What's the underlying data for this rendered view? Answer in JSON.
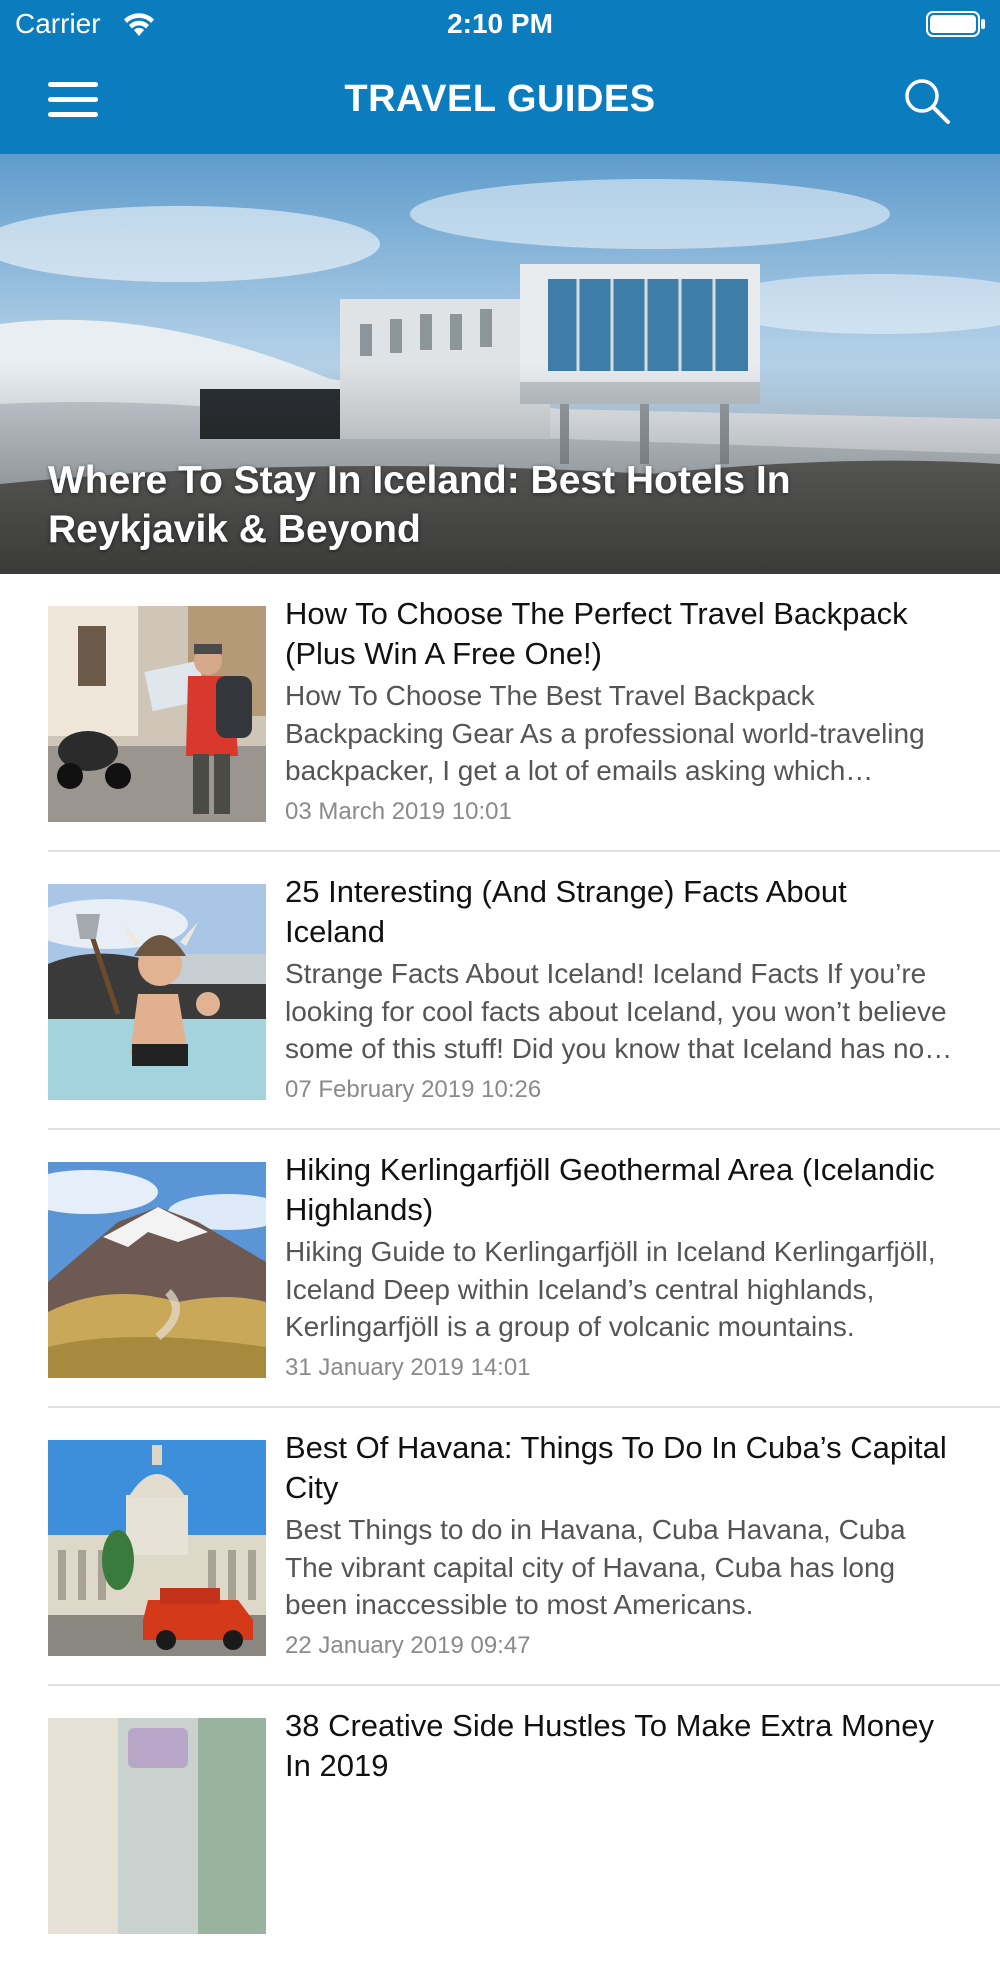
{
  "status_bar": {
    "carrier": "Carrier",
    "time": "2:10 PM",
    "icons": [
      "wifi-icon",
      "battery-icon"
    ]
  },
  "nav_bar": {
    "title": "TRAVEL GUIDES",
    "background": "#0b7dbf",
    "icons": [
      "hamburger-menu-icon",
      "search-icon"
    ]
  },
  "featured": {
    "title": "Where To Stay In Iceland: Best Hotels In Reykjavik & Beyond"
  },
  "articles": [
    {
      "title": "How To Choose The Perfect Travel Backpack (Plus Win A Free One!)",
      "excerpt": "How To Choose The Best Travel Backpack Backpacking Gear  As a professional world-traveling backpacker, I get a lot of emails asking which backpack is best.",
      "date": "03 March 2019 10:01"
    },
    {
      "title": "25 Interesting (And Strange) Facts About Iceland",
      "excerpt": "Strange Facts About Iceland!   Iceland Facts If you’re looking for cool facts about Iceland, you won’t believe some of this stuff! Did you know that Iceland has no mosquitoes?",
      "date": "07 February 2019 10:26"
    },
    {
      "title": "Hiking Kerlingarfjöll Geothermal Area (Icelandic Highlands)",
      "excerpt": "Hiking Guide to Kerlingarfjöll in Iceland Kerlingarfjöll, Iceland  Deep within Iceland’s central highlands, Kerlingarfjöll is a group of volcanic mountains.",
      "date": "31 January 2019 14:01"
    },
    {
      "title": "Best Of Havana: Things To Do In Cuba’s Capital City",
      "excerpt": "Best Things to do in Havana, Cuba   Havana, Cuba  The vibrant capital city of Havana, Cuba has long been inaccessible to most Americans.",
      "date": "22 January 2019 09:47"
    },
    {
      "title": "38 Creative Side Hustles To Make Extra Money In 2019",
      "excerpt": "",
      "date": ""
    }
  ]
}
